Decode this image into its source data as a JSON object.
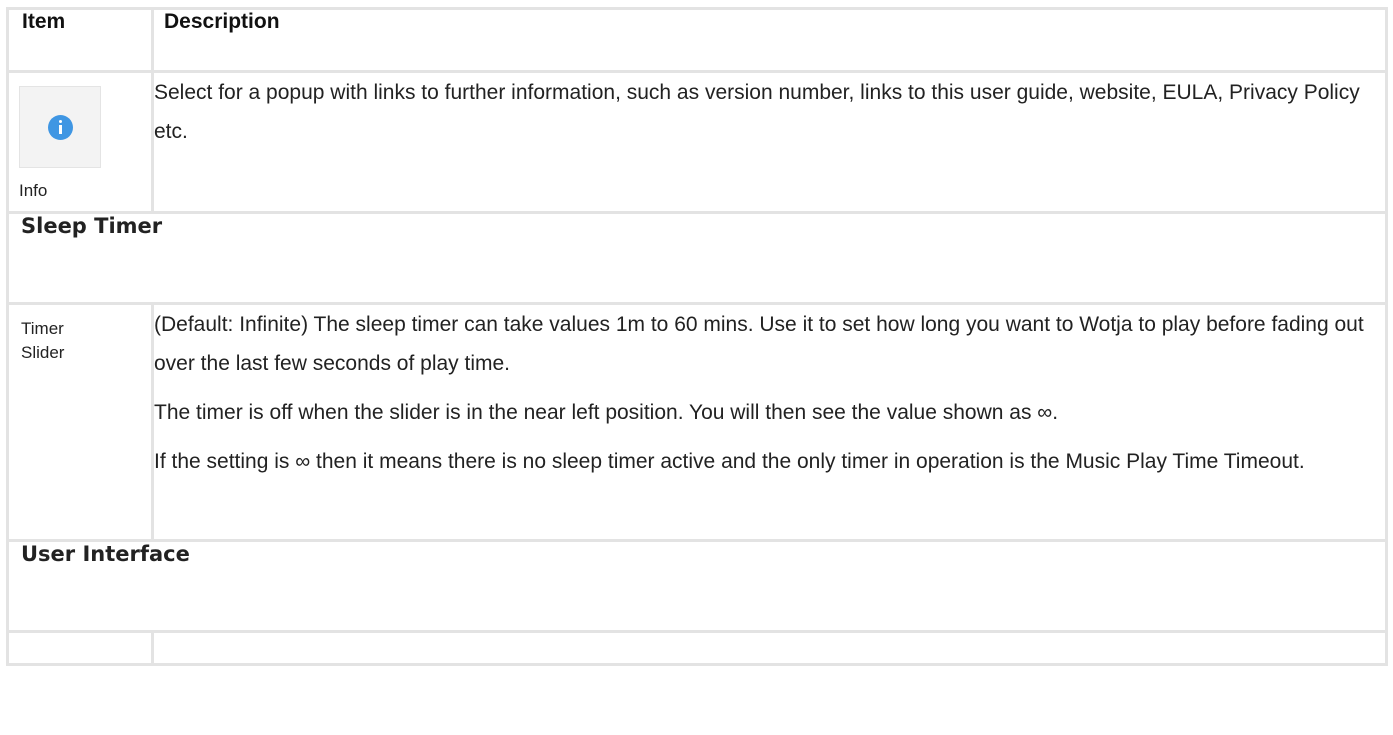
{
  "table": {
    "headers": {
      "item": "Item",
      "description": "Description"
    },
    "info_row": {
      "icon": "info-circle-icon",
      "icon_color": "#3f96e3",
      "item_label": "Info",
      "description": "Select for a popup with links to further information, such as version number, links to this user guide, website, EULA, Privacy Policy etc."
    },
    "sections": {
      "sleep_timer": "Sleep Timer",
      "user_interface": "User Interface"
    },
    "timer_row": {
      "item_label": "Timer Slider",
      "paragraphs": [
        "(Default: Infinite) The sleep timer can take values 1m to 60 mins. Use it to set how long you want to Wotja to play before fading out over the last few seconds of play time.",
        "The timer is off when the slider is in the near left position. You will then see the value shown as ∞.",
        "If the setting is ∞ then it means there is no sleep timer active and the only timer in operation is the Music Play Time Timeout."
      ]
    },
    "border_color": "#e3e3e3"
  }
}
